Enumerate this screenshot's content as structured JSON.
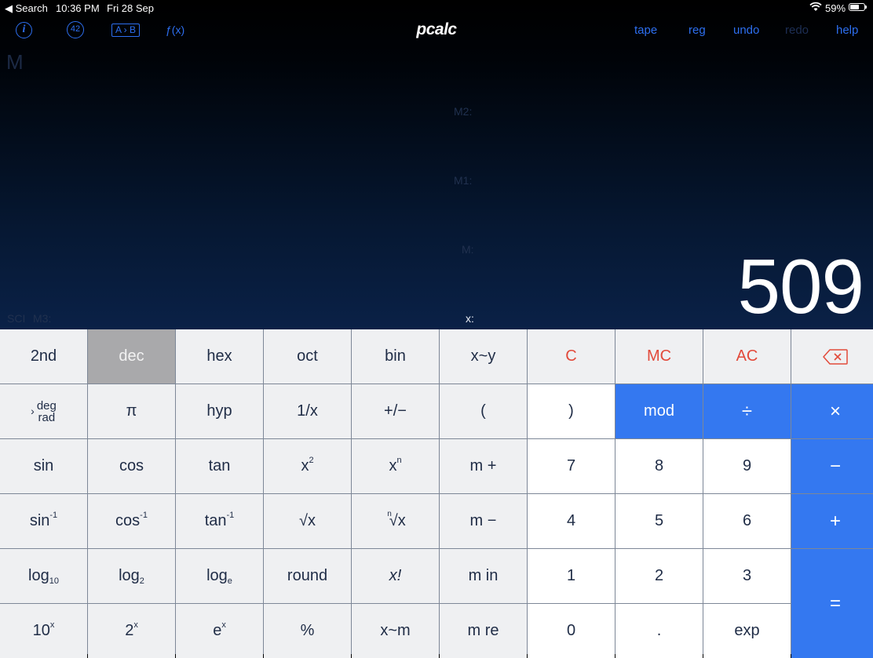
{
  "status": {
    "back": "◀ Search",
    "time": "10:36 PM",
    "date": "Fri 28 Sep",
    "battery": "59%"
  },
  "toolbar": {
    "info": "i",
    "answer": "42",
    "convert": "A › B",
    "functions": "ƒ(x)",
    "title": "pcalc",
    "tape": "tape",
    "reg": "reg",
    "undo": "undo",
    "redo": "redo",
    "help": "help"
  },
  "display": {
    "memory_indicator": "M",
    "m2_label": "M2:",
    "m1_label": "M1:",
    "m_label": "M:",
    "mode": "SCI",
    "m3_label": "M3:",
    "x_label": "x:",
    "x_value": "509"
  },
  "keys": {
    "r1": [
      "2nd",
      "dec",
      "hex",
      "oct",
      "bin",
      "x~y",
      "C",
      "MC",
      "AC"
    ],
    "r2": {
      "deg": "deg",
      "rad": "rad",
      "pi": "π",
      "hyp": "hyp",
      "recip": "1/x",
      "negate": "+/−",
      "lparen": "(",
      "rparen": ")",
      "mod": "mod",
      "div": "÷",
      "mul": "×"
    },
    "r3": {
      "sin": "sin",
      "cos": "cos",
      "tan": "tan",
      "sq": "x",
      "sq_sup": "2",
      "pow": "x",
      "pow_sup": "n",
      "mplus": "m +",
      "k7": "7",
      "k8": "8",
      "k9": "9",
      "minus": "−"
    },
    "r4": {
      "asin": "sin",
      "acos": "cos",
      "atan": "tan",
      "inv_sup": "-1",
      "sqrt": "√x",
      "nroot": "∜x",
      "nroot_n": "n",
      "mminus": "m −",
      "k4": "4",
      "k5": "5",
      "k6": "6",
      "plus": "+"
    },
    "r5": {
      "log": "log",
      "log_sub10": "10",
      "log_sub2": "2",
      "log_sube": "e",
      "round": "round",
      "fact": "x!",
      "min": "m in",
      "k1": "1",
      "k2": "2",
      "k3": "3",
      "eq": "="
    },
    "r6": {
      "ten": "10",
      "two": "2",
      "e": "e",
      "exp_sup": "x",
      "pct": "%",
      "xm": "x~m",
      "mre": "m re",
      "k0": "0",
      "dot": ".",
      "exp": "exp"
    }
  },
  "colors": {
    "accent": "#3478f0",
    "clear_red": "#e24a3b",
    "selected": "#a9a9ab"
  }
}
